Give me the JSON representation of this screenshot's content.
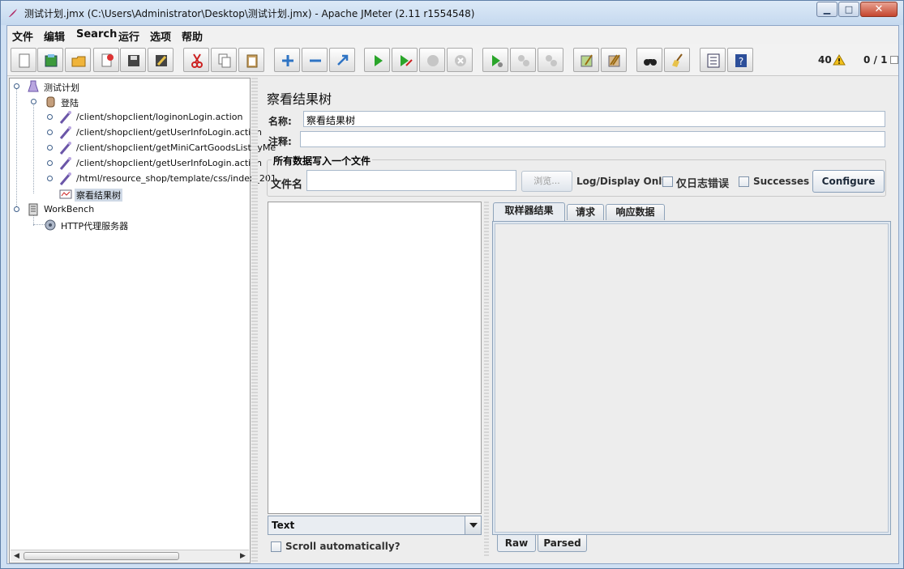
{
  "window": {
    "title": "测试计划.jmx (C:\\Users\\Administrator\\Desktop\\测试计划.jmx) - Apache JMeter (2.11 r1554548)"
  },
  "menu": [
    "文件",
    "编辑",
    "Search",
    "运行",
    "选项",
    "帮助"
  ],
  "toolbar": {
    "icons": [
      "new-icon",
      "templates-icon",
      "open-icon",
      "close-icon",
      "save-icon",
      "save-as-icon",
      "cut-icon",
      "copy-icon",
      "paste-icon",
      "expand-icon",
      "collapse-icon",
      "toggle-icon",
      "start-icon",
      "start-no-pause-icon",
      "stop-icon",
      "shutdown-icon",
      "remote-start-icon",
      "remote-stop-icon",
      "remote-shutdown-icon",
      "clear-icon",
      "clear-all-icon",
      "search-icon",
      "reset-search-icon",
      "function-helper-icon",
      "help-icon"
    ],
    "warning_count": "40",
    "threads": "0 / 1"
  },
  "tree": {
    "items": [
      {
        "label": "测试计划",
        "icon": "test-plan-icon"
      },
      {
        "label": "登陆",
        "icon": "thread-group-icon"
      },
      {
        "label": "/client/shopclient/loginonLogin.action",
        "icon": "http-sampler-icon"
      },
      {
        "label": "/client/shopclient/getUserInfoLogin.action",
        "icon": "http-sampler-icon"
      },
      {
        "label": "/client/shopclient/getMiniCartGoodsListByMe",
        "icon": "http-sampler-icon"
      },
      {
        "label": "/client/shopclient/getUserInfoLogin.action",
        "icon": "http-sampler-icon"
      },
      {
        "label": "/html/resource_shop/template/css/index_201",
        "icon": "http-sampler-icon"
      },
      {
        "label": "察看结果树",
        "icon": "listener-icon"
      },
      {
        "label": "WorkBench",
        "icon": "workbench-icon"
      },
      {
        "label": "HTTP代理服务器",
        "icon": "proxy-icon"
      }
    ]
  },
  "panel": {
    "title": "察看结果树",
    "name_label": "名称:",
    "name_value": "察看结果树",
    "comment_label": "注释:",
    "comment_value": "",
    "file_group_title": "所有数据写入一个文件",
    "filename_label": "文件名",
    "filename_value": "",
    "browse_label": "浏览...",
    "log_display_label": "Log/Display Only:",
    "errors_only_label": "仅日志错误",
    "successes_label": "Successes",
    "configure_label": "Configure",
    "renderer_value": "Text",
    "scroll_auto_label": "Scroll automatically?",
    "tabs": [
      "取样器结果",
      "请求",
      "响应数据"
    ],
    "bottom_tabs": [
      "Raw",
      "Parsed"
    ]
  }
}
